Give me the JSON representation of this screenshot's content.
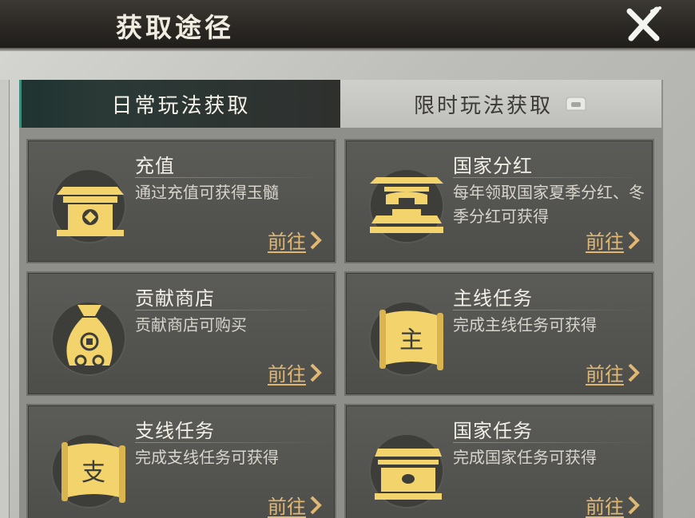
{
  "header": {
    "title": "获取途径"
  },
  "tabs": [
    {
      "label": "日常玩法获取",
      "active": true
    },
    {
      "label": "限时玩法获取",
      "active": false
    }
  ],
  "cards": [
    {
      "name": "充值",
      "desc": "通过充值可获得玉髓",
      "action": "前往",
      "icon": "gate-coin-icon"
    },
    {
      "name": "国家分红",
      "desc": "每年领取国家夏季分红、冬季分红可获得",
      "action": "前往",
      "icon": "pavilion-icon"
    },
    {
      "name": "贡献商店",
      "desc": "贡献商店可购买",
      "action": "前往",
      "icon": "money-bag-icon"
    },
    {
      "name": "主线任务",
      "desc": "完成主线任务可获得",
      "action": "前往",
      "icon": "scroll-main-icon"
    },
    {
      "name": "支线任务",
      "desc": "完成支线任务可获得",
      "action": "前往",
      "icon": "scroll-branch-icon"
    },
    {
      "name": "国家任务",
      "desc": "完成国家任务可获得",
      "action": "前往",
      "icon": "treasure-chest-icon"
    }
  ],
  "scroll_glyphs": {
    "main": "主",
    "branch": "支"
  },
  "colors": {
    "gold": "#e0b874",
    "icon_gold": "#f3d36c",
    "tab_accent": "#3e8b7c"
  }
}
